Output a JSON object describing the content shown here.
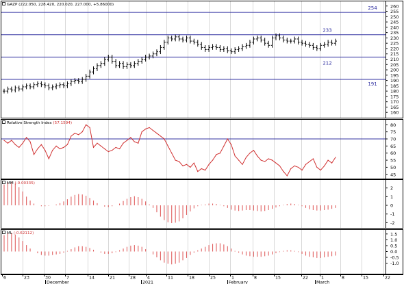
{
  "colors": {
    "hline": "#3030a0",
    "hline_label": "#3030a0",
    "rsi_line": "#d03030",
    "osc_bar": "#e06060",
    "grid": "#d8d8d8",
    "frame": "#000000",
    "price": "#000000",
    "legend_value": "#d03030"
  },
  "x_axis": {
    "tick_labels": [
      "6",
      "23",
      "30",
      "7",
      "14",
      "21",
      "28",
      "4",
      "11",
      "18",
      "25",
      "1",
      "8",
      "15",
      "22",
      "1",
      "8",
      "15",
      "22"
    ],
    "month_labels": [
      "December",
      "2021",
      "February",
      "March"
    ]
  },
  "chart_data": [
    {
      "type": "candlestick",
      "title_name": "GAZP",
      "title_values": "(222.050, 228.420, 220.020, 227.000, +5.86000)",
      "ylim": [
        155,
        265
      ],
      "y_ticks": [
        160,
        165,
        170,
        175,
        180,
        185,
        190,
        195,
        200,
        205,
        210,
        215,
        220,
        225,
        230,
        235,
        240,
        245,
        250,
        255,
        260
      ],
      "horizontal_lines": [
        {
          "value": 254,
          "label": "254"
        },
        {
          "value": 233,
          "label": "233"
        },
        {
          "value": 212,
          "label": "212"
        },
        {
          "value": 191,
          "label": "191"
        }
      ],
      "values": [
        180,
        182,
        181,
        183,
        182,
        184,
        185,
        184,
        186,
        187,
        186,
        185,
        183,
        184,
        185,
        186,
        185,
        187,
        189,
        190,
        189,
        191,
        194,
        198,
        201,
        204,
        206,
        210,
        212,
        208,
        204,
        206,
        203,
        205,
        204,
        206,
        208,
        210,
        212,
        213,
        215,
        217,
        221,
        226,
        230,
        229,
        231,
        229,
        228,
        230,
        227,
        226,
        224,
        221,
        219,
        221,
        222,
        221,
        219,
        220,
        218,
        217,
        219,
        220,
        222,
        223,
        226,
        229,
        230,
        228,
        225,
        223,
        230,
        232,
        230,
        228,
        227,
        227,
        229,
        226,
        225,
        224,
        223,
        221,
        220,
        223,
        224,
        226,
        225,
        227
      ]
    },
    {
      "type": "line",
      "title_name": "Relative Strength Index",
      "title_values": "(57.1594)",
      "ylim": [
        42,
        84
      ],
      "y_ticks": [
        45,
        50,
        55,
        60,
        65,
        70,
        75,
        80
      ],
      "horizontal_lines": [
        {
          "value": 70,
          "label": ""
        }
      ],
      "values": [
        69,
        67,
        69,
        66,
        64,
        67,
        71,
        68,
        59,
        63,
        66,
        62,
        56,
        62,
        65,
        63,
        64,
        66,
        72,
        74,
        73,
        75,
        80,
        78,
        64,
        67,
        65,
        63,
        61,
        62,
        64,
        63,
        67,
        69,
        71,
        68,
        67,
        75,
        77,
        78,
        76,
        74,
        72,
        70,
        65,
        60,
        55,
        54,
        51,
        52,
        50,
        53,
        47,
        49,
        48,
        52,
        55,
        59,
        60,
        65,
        70,
        66,
        58,
        55,
        52,
        57,
        60,
        62,
        58,
        55,
        54,
        56,
        55,
        53,
        51,
        47,
        44,
        49,
        51,
        50,
        48,
        52,
        54,
        56,
        50,
        48,
        51,
        55,
        53,
        57
      ]
    },
    {
      "type": "bar",
      "title_name": "MM",
      "title_values": "(-0.00335)",
      "ylim": [
        -2.6,
        3.0
      ],
      "y_ticks": [
        -2,
        -1,
        0,
        1,
        2
      ],
      "values": [
        2.4,
        2.65,
        2.7,
        2.5,
        2.1,
        1.6,
        1.0,
        0.55,
        0.2,
        0.0,
        -0.1,
        -0.1,
        -0.05,
        0.0,
        0.1,
        0.25,
        0.45,
        0.7,
        1.0,
        1.2,
        1.3,
        1.25,
        1.1,
        0.85,
        0.55,
        0.25,
        0.0,
        -0.15,
        -0.2,
        -0.1,
        0.0,
        0.2,
        0.5,
        0.75,
        0.95,
        1.05,
        0.95,
        0.75,
        0.45,
        0.1,
        -0.3,
        -0.8,
        -1.3,
        -1.7,
        -1.95,
        -2.05,
        -2.0,
        -1.85,
        -1.5,
        -1.1,
        -0.7,
        -0.35,
        -0.1,
        0.05,
        0.1,
        0.2,
        0.2,
        0.15,
        0.05,
        -0.1,
        -0.3,
        -0.5,
        -0.6,
        -0.65,
        -0.6,
        -0.55,
        -0.55,
        -0.6,
        -0.65,
        -0.7,
        -0.65,
        -0.55,
        -0.4,
        -0.25,
        -0.1,
        0.05,
        0.15,
        0.2,
        0.15,
        0.05,
        -0.1,
        -0.3,
        -0.45,
        -0.55,
        -0.6,
        -0.6,
        -0.55,
        -0.5,
        -0.4,
        -0.3
      ]
    },
    {
      "type": "bar",
      "title_name": "ML",
      "title_values": "(-0.62112)",
      "ylim": [
        -1.9,
        1.9
      ],
      "y_ticks": [
        -1.0,
        -0.5,
        0.0,
        0.5,
        1.0,
        1.5
      ],
      "y_tick_labels": [
        "-1.0",
        "-0.5",
        "0.0",
        "0.5",
        "1.0",
        "1.5"
      ],
      "values": [
        1.4,
        1.55,
        1.6,
        1.45,
        1.2,
        0.9,
        0.55,
        0.25,
        0.0,
        -0.15,
        -0.3,
        -0.35,
        -0.35,
        -0.3,
        -0.25,
        -0.2,
        -0.1,
        0.05,
        0.2,
        0.35,
        0.45,
        0.45,
        0.4,
        0.3,
        0.15,
        0.0,
        -0.1,
        -0.2,
        -0.2,
        -0.15,
        -0.05,
        0.1,
        0.25,
        0.4,
        0.5,
        0.55,
        0.5,
        0.4,
        0.2,
        0.0,
        -0.25,
        -0.5,
        -0.75,
        -0.95,
        -1.05,
        -1.1,
        -1.05,
        -0.95,
        -0.75,
        -0.55,
        -0.3,
        -0.1,
        0.1,
        0.25,
        0.4,
        0.55,
        0.65,
        0.7,
        0.7,
        0.6,
        0.45,
        0.25,
        0.05,
        -0.1,
        -0.25,
        -0.35,
        -0.4,
        -0.45,
        -0.45,
        -0.45,
        -0.4,
        -0.35,
        -0.25,
        -0.15,
        -0.05,
        0.05,
        0.1,
        0.1,
        0.05,
        -0.05,
        -0.2,
        -0.35,
        -0.45,
        -0.5,
        -0.55,
        -0.55,
        -0.5,
        -0.45,
        -0.4,
        -0.35
      ]
    }
  ]
}
